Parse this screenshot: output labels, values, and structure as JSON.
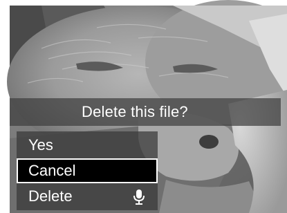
{
  "dialog": {
    "title": "Delete this file?"
  },
  "menu": {
    "items": [
      {
        "label": "Yes",
        "selected": false
      },
      {
        "label": "Cancel",
        "selected": true
      },
      {
        "label": "Delete",
        "selected": false,
        "icon": "microphone-icon"
      }
    ]
  },
  "background": {
    "content": "grayscale photo of a sleeping cat"
  }
}
